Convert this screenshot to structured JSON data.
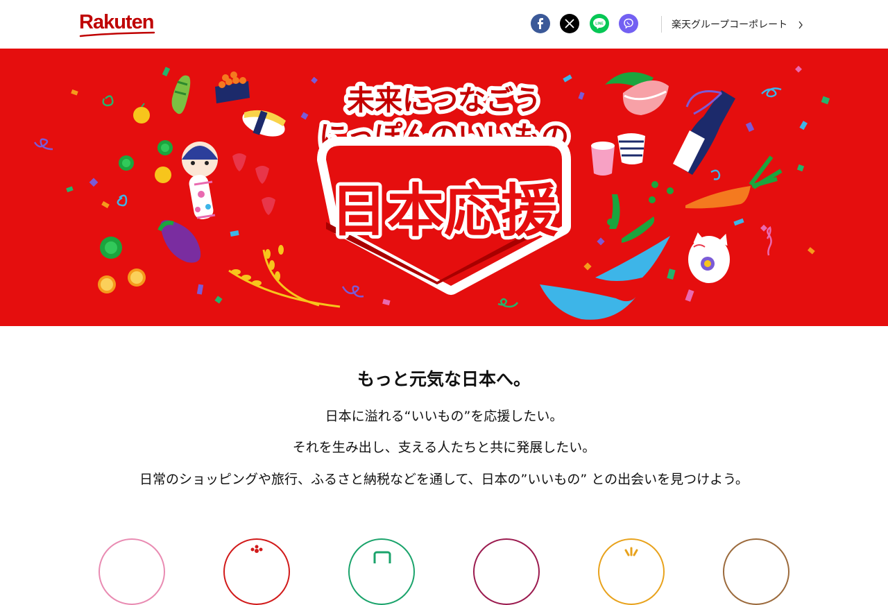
{
  "header": {
    "logo_text": "Rakuten",
    "corp_link_label": "楽天グループコーポレート",
    "social": [
      {
        "name": "facebook-icon",
        "color": "#3b5998"
      },
      {
        "name": "x-icon",
        "color": "#000000"
      },
      {
        "name": "line-icon",
        "color": "#06c755"
      },
      {
        "name": "viber-icon",
        "color": "#7360f2"
      }
    ]
  },
  "hero": {
    "tagline_line1": "未来につなごう",
    "tagline_line2": "にっぽんのいいもの",
    "badge_text": "日本応援",
    "background_color": "#e50e0e"
  },
  "intro": {
    "heading": "もっと元気な日本へ。",
    "lines": [
      "日本に溢れる“いいもの”を応援したい。",
      "それを生み出し、支える人たちと共に発展したい。",
      "日常のショッピングや旅行、ふるさと納税などを通して、日本の”いいもの” との出会いを見つけよう。"
    ]
  },
  "category_circles": [
    {
      "name": "category-circle-1",
      "color": "#e98bb2"
    },
    {
      "name": "category-circle-2",
      "color": "#d11a1a"
    },
    {
      "name": "category-circle-3",
      "color": "#1aa36b"
    },
    {
      "name": "category-circle-4",
      "color": "#9b1b4f"
    },
    {
      "name": "category-circle-5",
      "color": "#e8a21c"
    },
    {
      "name": "category-circle-6",
      "color": "#9b6a3c"
    }
  ]
}
